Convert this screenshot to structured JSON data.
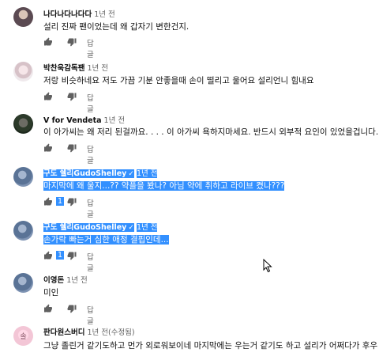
{
  "comments": [
    {
      "author": "나다나다나다다",
      "time": "1년 전",
      "text": "설리 진짜 팬이었는데 왜 갑자기 변한건지.",
      "reply_label": "답글",
      "likes": "",
      "avatar_icon": "avatar-icon"
    },
    {
      "author": "박찬욱감독팬",
      "time": "1년 전",
      "text": "저랑 비슷하네요 저도 가끔 기분 안좋을때 손이 떨리고 울어요 설리언니 힘내요",
      "reply_label": "답글",
      "likes": "",
      "avatar_icon": "avatar-icon"
    },
    {
      "author": "V for Vendeta",
      "time": "1년 전",
      "text": "이 아가씨는 왜 저리 된걸까요. . . . 이 아가씨 욕하지마세요.  반드시 외부적 요인이 있었을겁니다.. 또",
      "reply_label": "답글",
      "likes": "",
      "avatar_icon": "avatar-icon"
    },
    {
      "author": "구도 쉘리GudoShelley",
      "time": "1년 전",
      "text": "마지막에 왜 울지...?? 약플을 봤나? 아님 약에 취하고 라이브 켰나???",
      "reply_label": "답글",
      "likes": "1",
      "avatar_icon": "avatar-icon"
    },
    {
      "author": "구도 쉘리GudoShelley",
      "time": "1년 전",
      "text": "손가락 빠는거 심한 애정 결핍인데...",
      "reply_label": "답글",
      "likes": "1",
      "avatar_icon": "avatar-icon"
    },
    {
      "author": "이영돈",
      "time": "1년 전",
      "text": "미인",
      "reply_label": "답글",
      "likes": "",
      "avatar_icon": "avatar-icon"
    },
    {
      "author": "판다원스버디",
      "time": "1년 전(수정됨)",
      "text": "그냥 졸린거 같기도하고 먼가 외로워보이네 마지막에는 우는거 같기도 하고 설리가 어쩌다가 후우",
      "reply_label": "답글",
      "likes": "",
      "avatar_icon": "avatar-icon",
      "avatar_text": "솔"
    }
  ],
  "icons": {
    "like": "thumb-up-icon",
    "dislike": "thumb-down-icon",
    "check": "verified-check-icon",
    "cursor": "mouse-cursor-icon"
  },
  "colors": {
    "selection": "#3390ff",
    "secondary_text": "#606060",
    "primary_text": "#0f0f0f"
  }
}
